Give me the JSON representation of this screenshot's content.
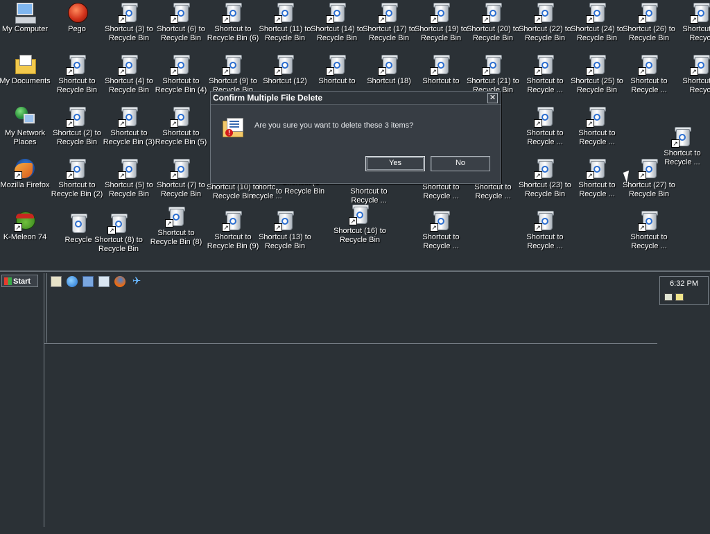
{
  "desktop": {
    "icons": {
      "my_computer": "My Computer",
      "pego": "Pego",
      "my_documents": "My Documents",
      "my_network": "My Network Places",
      "firefox": "Mozilla Firefox",
      "kmeleon": "K-Meleon 74",
      "recycle": "Recycle",
      "r0": [
        "Shortcut (3) to Recycle Bin",
        "Shortcut (6) to Recycle Bin",
        "Shortcut to Recycle Bin (6)",
        "Shortcut (11) to Recycle Bin",
        "Shortcut (14) to Recycle Bin",
        "Shortcut (17) to Recycle Bin",
        "Shortcut (19) to Recycle Bin",
        "Shortcut (20) to Recycle Bin",
        "Shortcut (22) to Recycle Bin",
        "Shortcut (24) to Recycle Bin",
        "Shortcut (26) to Recycle Bin",
        "Shortcut to Recycl"
      ],
      "r1": [
        "Shortcut to Recycle Bin",
        "Shortcut (4) to Recycle Bin",
        "Shortcut to Recycle Bin (4)",
        "Shortcut (9) to Recycle Bin",
        "Shortcut (12)",
        "Shortcut to",
        "Shortcut (18)",
        "Shortcut to",
        "Shortcut (21) to Recycle Bin",
        "Shortcut to Recycle ...",
        "Shortcut (25) to Recycle Bin",
        "Shortcut to Recycle ...",
        "Shortcut to Recycl"
      ],
      "r2": [
        "Shortcut (2) to Recycle Bin",
        "Shortcut to Recycle Bin (3)",
        "Shortcut to Recycle Bin (5)",
        "Shortcut to Recycle ...",
        "Shortcut to Recycle ...",
        "Shortcut to Recycle ..."
      ],
      "r3": [
        "Shortcut to Recycle Bin (2)",
        "Shortcut (5) to Recycle Bin",
        "Shortcut (7) to Recycle Bin",
        "Shortcut (10) to Recycle Bin",
        "Shortcut to Recycle ...",
        "Shortcut to Recycle ...",
        "Shortcut (23) to Recycle Bin",
        "Shortcut to Recycle ...",
        "Shortcut (27) to Recycle Bin"
      ],
      "r4": [
        "Shortcut (8) to Recycle Bin",
        "Shortcut to Recycle Bin (8)",
        "Shortcut to Recycle Bin (9)",
        "Shortcut (13) to Recycle Bin",
        "Shortcut (16) to Recycle Bin",
        "Shortcut to Recycle ...",
        "Shortcut to Recycle ...",
        "Shortcut to Recycle ..."
      ],
      "partial": {
        "a": "Shortcut (1",
        "a2": "to Recycle Bin",
        "b": "hortc",
        "b2": "ecycle ...",
        "c": "Shortcut to",
        "c2": "Recycle ..."
      }
    }
  },
  "dialog": {
    "title": "Confirm Multiple File Delete",
    "close_glyph": "✕",
    "message": "Are you sure you want to delete these 3 items?",
    "yes": "Yes",
    "no": "No"
  },
  "taskbar": {
    "start_label": "Start",
    "clock": "6:32 PM",
    "quick_launch": [
      "show-desktop-icon",
      "internet-explorer-icon",
      "outlook-express-icon",
      "search-icon",
      "firefox-icon",
      "messenger-icon"
    ]
  }
}
